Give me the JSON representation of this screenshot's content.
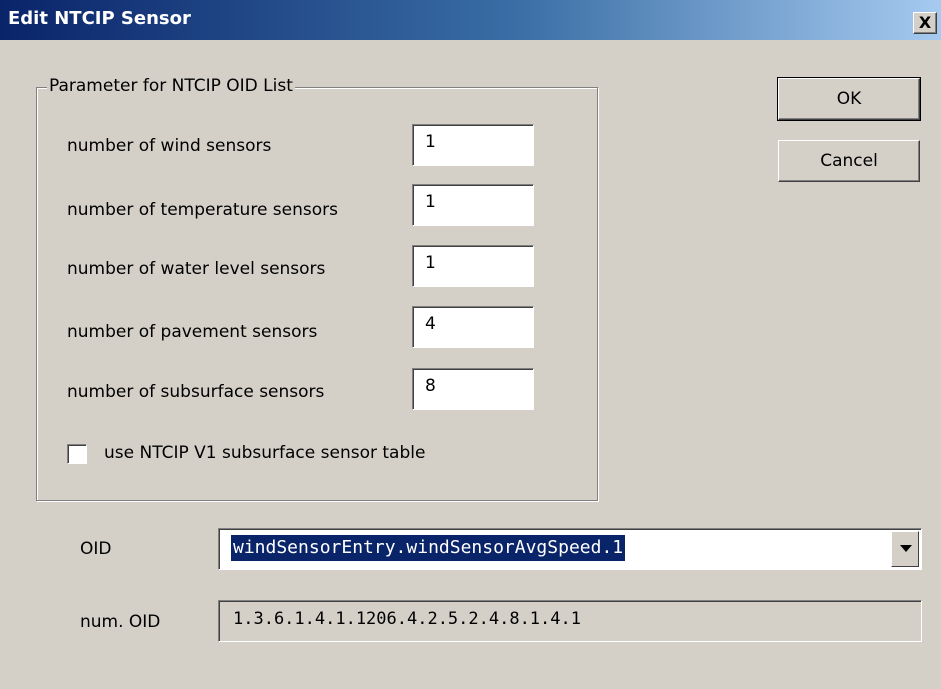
{
  "window": {
    "title": "Edit NTCIP Sensor",
    "close_label": "X"
  },
  "group": {
    "legend": "Parameter for NTCIP OID List",
    "rows": [
      {
        "label": "number of wind sensors",
        "value": "1"
      },
      {
        "label": "number of temperature sensors",
        "value": "1"
      },
      {
        "label": "number of water level sensors",
        "value": "1"
      },
      {
        "label": "number of pavement sensors",
        "value": "4"
      },
      {
        "label": "number of subsurface sensors",
        "value": "8"
      }
    ],
    "checkbox": {
      "label": "use NTCIP V1 subsurface sensor table",
      "checked": false
    }
  },
  "buttons": {
    "ok": "OK",
    "cancel": "Cancel"
  },
  "oid": {
    "label": "OID",
    "selected": "windSensorEntry.windSensorAvgSpeed.1"
  },
  "num_oid": {
    "label": "num. OID",
    "value": "1.3.6.1.4.1.1206.4.2.5.2.4.8.1.4.1"
  }
}
